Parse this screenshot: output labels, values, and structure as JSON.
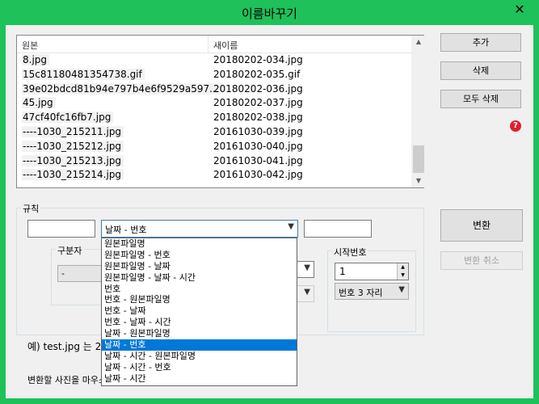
{
  "window": {
    "title": "이름바꾸기",
    "close_label": "✕"
  },
  "list": {
    "headers": [
      "원본",
      "새이름"
    ],
    "rows": [
      {
        "original": "8.jpg",
        "renamed": "20180202-034.jpg"
      },
      {
        "original": "15c81180481354738.gif",
        "renamed": "20180202-035.gif"
      },
      {
        "original": "39e02bdcd81b94e797b4e6f9529a597...",
        "renamed": "20180202-036.jpg"
      },
      {
        "original": "45.jpg",
        "renamed": "20180202-037.jpg"
      },
      {
        "original": "47cf40fc16fb7.jpg",
        "renamed": "20180202-038.jpg"
      },
      {
        "original": "----1030_215211.jpg",
        "renamed": "20161030-039.jpg"
      },
      {
        "original": "----1030_215212.jpg",
        "renamed": "20161030-040.jpg"
      },
      {
        "original": "----1030_215213.jpg",
        "renamed": "20161030-041.jpg"
      },
      {
        "original": "----1030_215214.jpg",
        "renamed": "20161030-042.jpg"
      }
    ]
  },
  "buttons": {
    "add": "추가",
    "delete": "삭제",
    "delete_all": "모두 삭제",
    "convert": "변환",
    "cancel_convert": "변환 취소"
  },
  "rules": {
    "group_label": "규칙",
    "prefix_value": "",
    "suffix_value": "",
    "pattern_selected": "날짜 - 번호",
    "pattern_options": [
      "원본파일명",
      "원본파일명 - 번호",
      "원본파일명 - 날짜",
      "원본파일명 - 날짜 - 시간",
      "번호",
      "번호 - 원본파일명",
      "번호 - 날짜",
      "번호 - 날짜 - 시간",
      "날짜 - 원본파일명",
      "날짜 - 번호",
      "날짜 - 시간 - 원본파일명",
      "날짜 - 시간 - 번호",
      "날짜 - 시간"
    ],
    "selected_index": 9,
    "separator_label": "구분자",
    "separator_value": "-",
    "start_number_label": "시작번호",
    "start_number_value": "1",
    "digits_value": "번호 3 자리",
    "example_text": "예) test.jpg 는 20",
    "hint_text": "변환할 사진을 마우스"
  },
  "icons": {
    "help": "?",
    "combo_arrow": "▼"
  }
}
